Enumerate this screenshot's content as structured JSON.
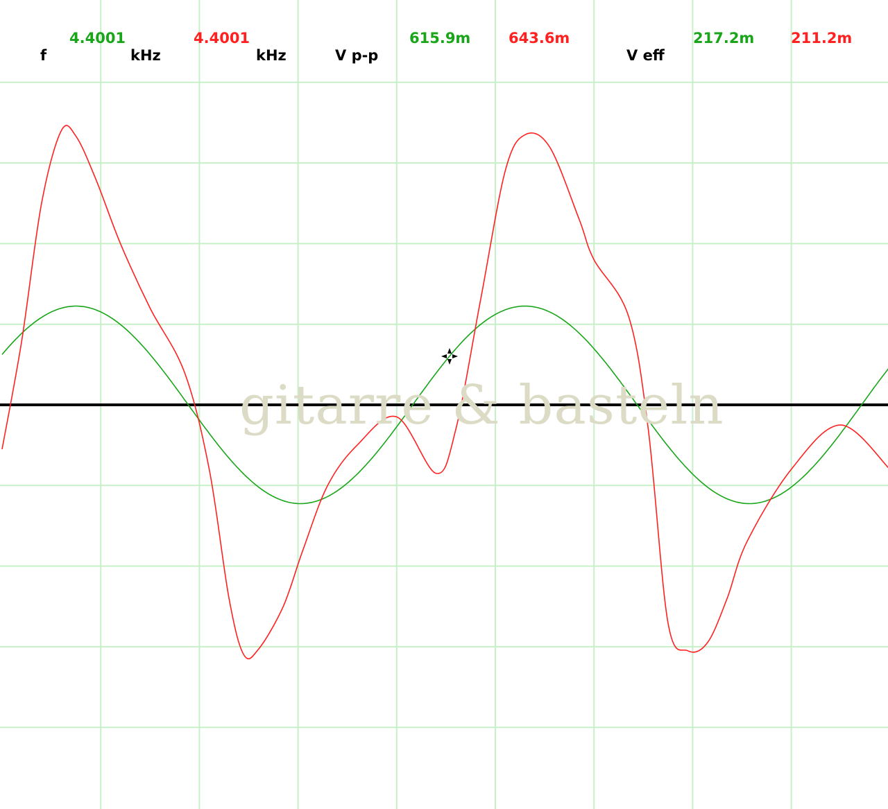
{
  "readouts": {
    "f_label": "f",
    "f_ch1": "4.4001",
    "f_unit1": "kHz",
    "f_ch2": "4.4001",
    "f_unit2": "kHz",
    "vpp_label": "V p-p",
    "vpp_ch1": "615.9m",
    "vpp_ch2": "643.6m",
    "veff_label": "V eff",
    "veff_ch1": "217.2m",
    "veff_ch2": "211.2m"
  },
  "watermark": "gitarre & basteln",
  "colors": {
    "background": "#ffffff",
    "grid": "#c8f0c8",
    "baseline": "#000000",
    "channel1": "#19a519",
    "channel2": "#ff2020",
    "watermark": "#dcdcc6"
  },
  "cursor_icon": "crosshair-cursor-icon",
  "chart_data": {
    "type": "line",
    "title": "",
    "xlabel": "",
    "ylabel": "",
    "grid": true,
    "xlim": [
      0,
      9
    ],
    "ylim": [
      -5,
      5
    ],
    "period_divisions": 4.55,
    "series": [
      {
        "name": "",
        "color": "#19a519",
        "amplitude_div": 1.225,
        "phase_div": 0.75,
        "x": [
          0,
          0.25,
          0.5,
          0.75,
          1.0,
          1.25,
          1.5,
          1.75,
          2.0,
          2.25,
          2.5,
          2.75,
          3.0,
          3.25,
          3.5,
          3.75,
          4.0,
          4.25,
          4.5,
          4.75,
          5.0,
          5.25,
          5.5,
          5.75,
          6.0,
          6.25,
          6.5,
          6.75,
          7.0,
          7.25,
          7.5,
          7.75,
          8.0,
          8.25,
          8.5,
          8.75,
          9.0
        ],
        "y": [
          0.61,
          0.96,
          1.17,
          1.22,
          1.11,
          0.85,
          0.49,
          0.06,
          -0.37,
          -0.77,
          -1.06,
          -1.22,
          -1.21,
          -1.05,
          -0.75,
          -0.35,
          0.08,
          0.51,
          0.87,
          1.12,
          1.22,
          1.16,
          0.95,
          0.6,
          0.19,
          -0.25,
          -0.66,
          -0.98,
          -1.18,
          -1.22,
          -1.1,
          -0.84,
          -0.47,
          -0.04,
          0.39,
          0.78,
          1.07
        ]
      },
      {
        "name": "",
        "color": "#ff2020",
        "x": [
          0,
          0.2,
          0.4,
          0.6,
          0.75,
          0.95,
          1.2,
          1.5,
          1.85,
          2.1,
          2.3,
          2.45,
          2.6,
          2.85,
          3.05,
          3.3,
          3.6,
          4.0,
          4.4,
          4.6,
          4.85,
          5.1,
          5.3,
          5.55,
          5.85,
          6.0,
          6.35,
          6.55,
          6.75,
          6.95,
          7.15,
          7.35,
          7.55,
          8.0,
          8.5,
          9.0
        ],
        "y": [
          -0.55,
          0.8,
          2.5,
          3.4,
          3.33,
          2.8,
          2.0,
          1.2,
          0.4,
          -0.8,
          -2.4,
          -3.1,
          -3.03,
          -2.5,
          -1.8,
          -1.0,
          -0.5,
          -0.15,
          -0.85,
          -0.3,
          1.3,
          2.9,
          3.35,
          3.2,
          2.3,
          1.8,
          1.1,
          -0.3,
          -2.7,
          -3.05,
          -2.95,
          -2.4,
          -1.7,
          -0.8,
          -0.25,
          -0.8
        ]
      }
    ]
  }
}
